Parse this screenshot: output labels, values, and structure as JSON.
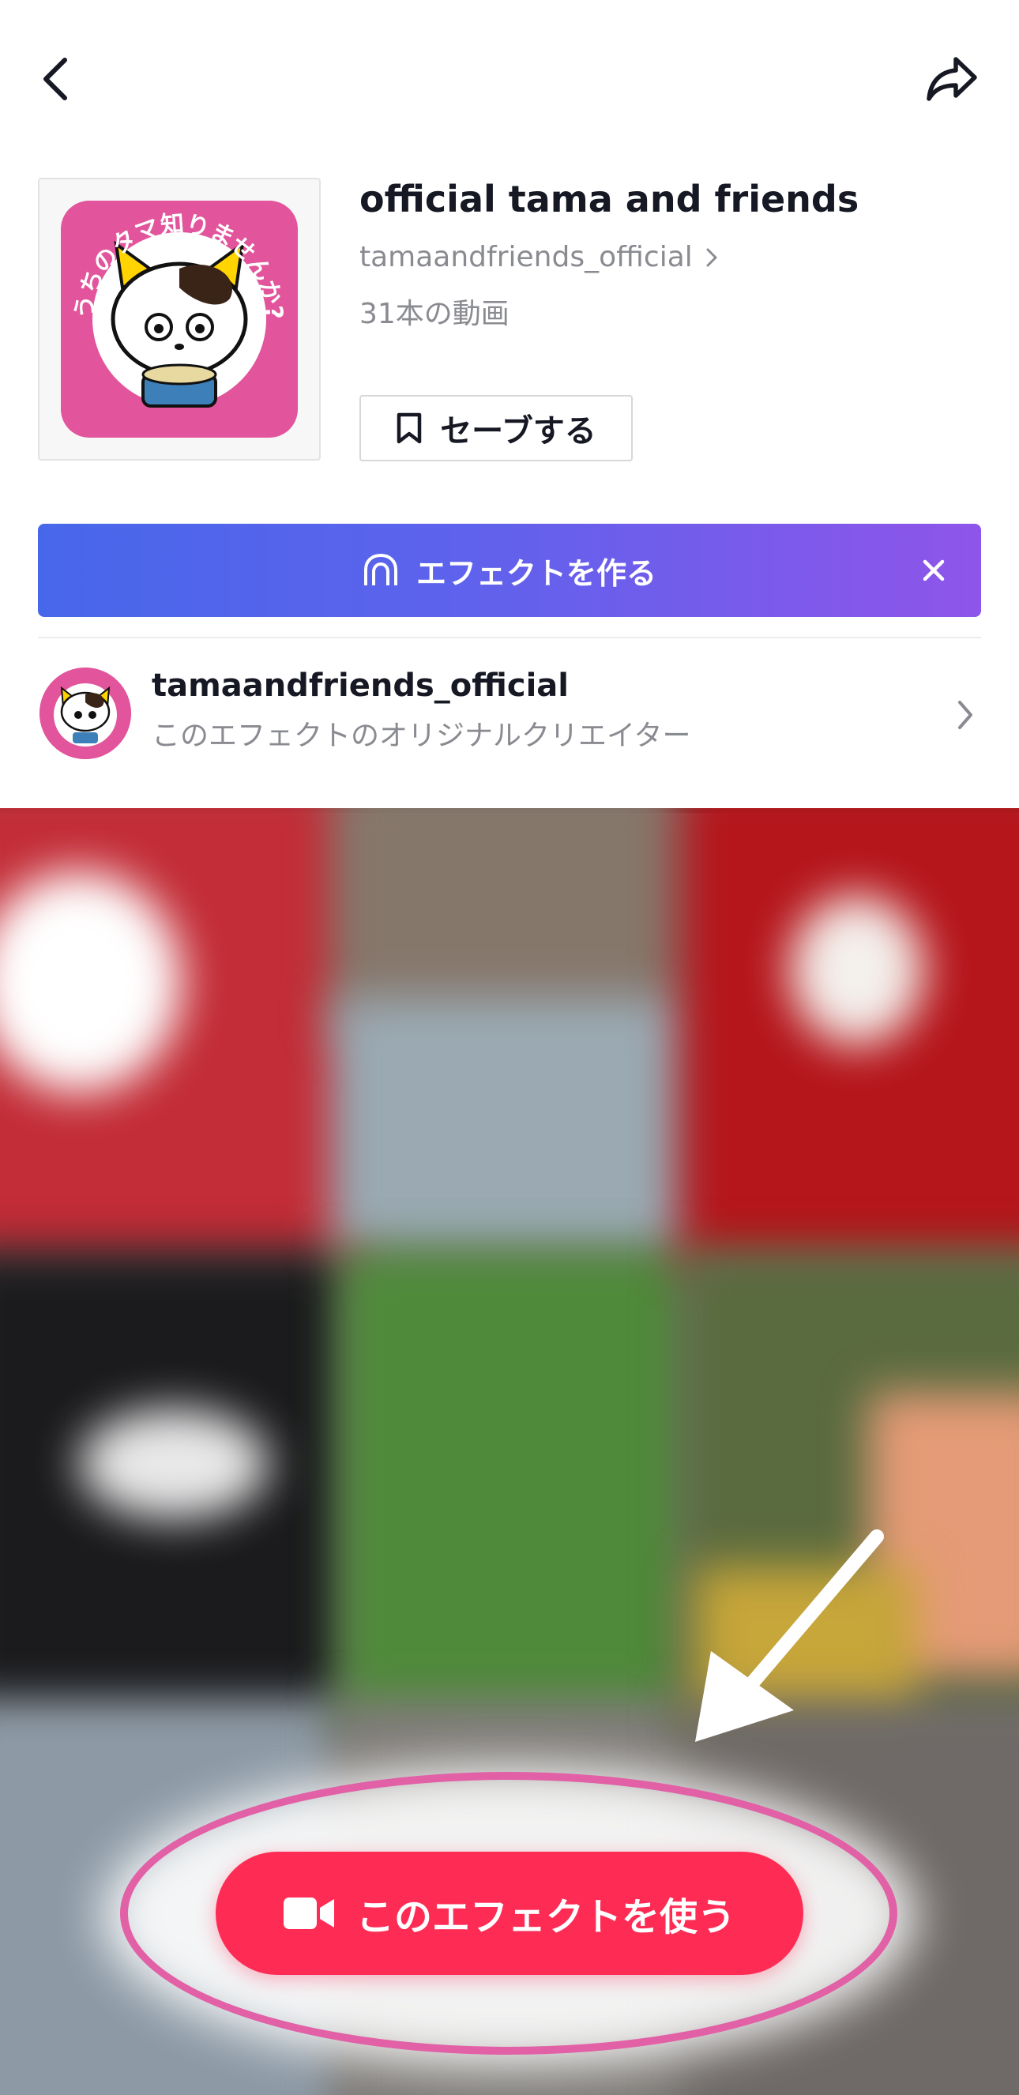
{
  "effect": {
    "title": "official tama and friends",
    "handle": "tamaandfriends_official",
    "video_count": "31本の動画",
    "save_label": "セーブする",
    "thumbnail_logo_text": "うちのタマ知りませんか?"
  },
  "banner": {
    "label": "エフェクトを作る"
  },
  "creator": {
    "name": "tamaandfriends_official",
    "subtitle": "このエフェクトのオリジナルクリエイター"
  },
  "primary_action": {
    "label": "このエフェクトを使う"
  },
  "icons": {
    "back": "chevron-left-icon",
    "share": "share-arrow-icon",
    "bookmark": "bookmark-icon",
    "effect_house": "effect-house-icon",
    "close": "close-icon",
    "chevron": "chevron-right-icon",
    "camera": "video-camera-icon"
  },
  "colors": {
    "accent_red": "#fe2c55",
    "banner_start": "#4767ea",
    "banner_end": "#8f55ea",
    "annotation_pink": "#e160a6"
  }
}
